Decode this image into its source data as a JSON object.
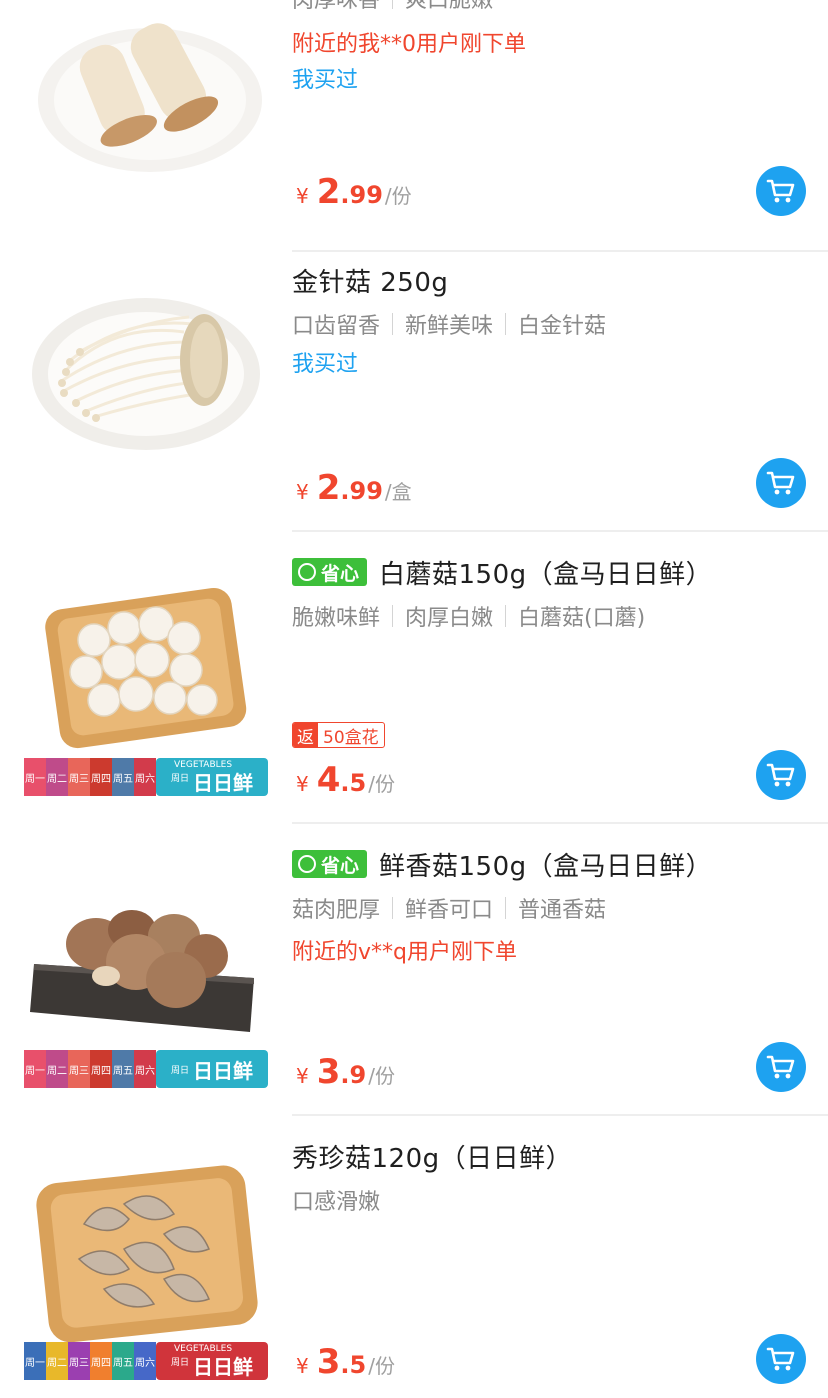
{
  "products": [
    {
      "title": "",
      "tags": [
        "肉厚味香",
        "爽口脆嫩"
      ],
      "notice": "附近的我**0用户刚下单",
      "bought": "我买过",
      "price_currency": "¥",
      "price_int": "2",
      "price_dec": ".99",
      "price_unit": "/份",
      "image": "king-oyster-mushroom-plate"
    },
    {
      "title": "金针菇 250g",
      "tags": [
        "口齿留香",
        "新鲜美味",
        "白金针菇"
      ],
      "bought": "我买过",
      "price_currency": "¥",
      "price_int": "2",
      "price_dec": ".99",
      "price_unit": "/盒",
      "image": "enoki-mushroom-plate"
    },
    {
      "badge": "省心",
      "title": "白蘑菇150g（盒马日日鲜）",
      "tags": [
        "脆嫩味鲜",
        "肉厚白嫩",
        "白蘑菇(口蘑)"
      ],
      "rebate_left": "返",
      "rebate_right": "50盒花",
      "price_currency": "¥",
      "price_int": "4",
      "price_dec": ".5",
      "price_unit": "/份",
      "image": "white-button-mushroom-tray",
      "banner": {
        "days": [
          "周一",
          "周二",
          "周三",
          "周四",
          "周五",
          "周六",
          "周日"
        ],
        "brand": "日日鲜",
        "brand_en": "VEGETABLES"
      }
    },
    {
      "badge": "省心",
      "title": "鲜香菇150g（盒马日日鲜）",
      "tags": [
        "菇肉肥厚",
        "鲜香可口",
        "普通香菇"
      ],
      "notice": "附近的v**q用户刚下单",
      "price_currency": "¥",
      "price_int": "3",
      "price_dec": ".9",
      "price_unit": "/份",
      "image": "shiitake-mushroom-slate",
      "banner": {
        "days": [
          "周一",
          "周二",
          "周三",
          "周四",
          "周五",
          "周六",
          "周日"
        ],
        "brand": "日日鲜",
        "brand_en": ""
      }
    },
    {
      "title": "秀珍菇120g（日日鲜）",
      "tags": [
        "口感滑嫩"
      ],
      "price_currency": "¥",
      "price_int": "3",
      "price_dec": ".5",
      "price_unit": "/份",
      "image": "oyster-mushroom-tray",
      "banner": {
        "days": [
          "周一",
          "周二",
          "周三",
          "周四",
          "周五",
          "周六",
          "周日"
        ],
        "brand": "日日鲜",
        "brand_en": "VEGETABLES"
      }
    }
  ],
  "colors": {
    "price_red": "#f0462e",
    "bought_blue": "#1ea2f0",
    "cart_blue": "#1ea2f0",
    "badge_green": "#3dbf3a",
    "tag_gray": "#8a8a8a"
  },
  "icons": {
    "cart": "shopping-cart-icon",
    "badge": "heart-icon"
  }
}
